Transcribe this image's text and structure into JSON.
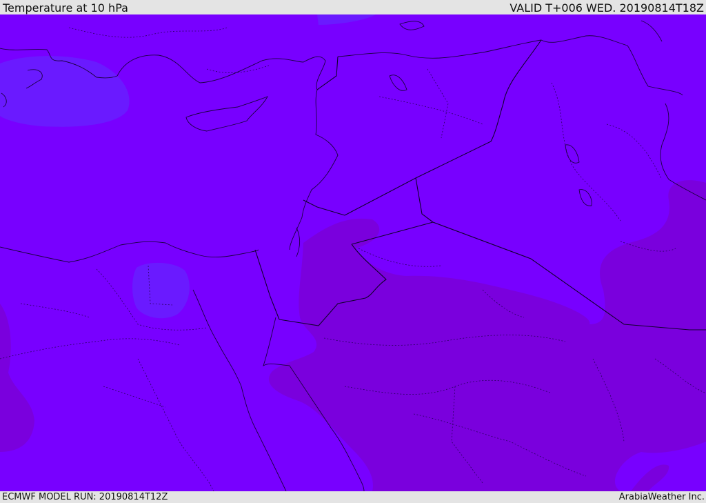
{
  "header": {
    "title": "Temperature at 10 hPa",
    "valid": "VALID T+006 WED. 20190814T18Z"
  },
  "footer": {
    "model_run": "ECMWF MODEL RUN: 20190814T12Z",
    "credit": "ArabiaWeather Inc."
  },
  "map": {
    "colors": {
      "base": "#7800ff",
      "cool_patch": "#6a1aff",
      "warm_patch": "#7a00dd",
      "border": "#1b0040"
    }
  }
}
